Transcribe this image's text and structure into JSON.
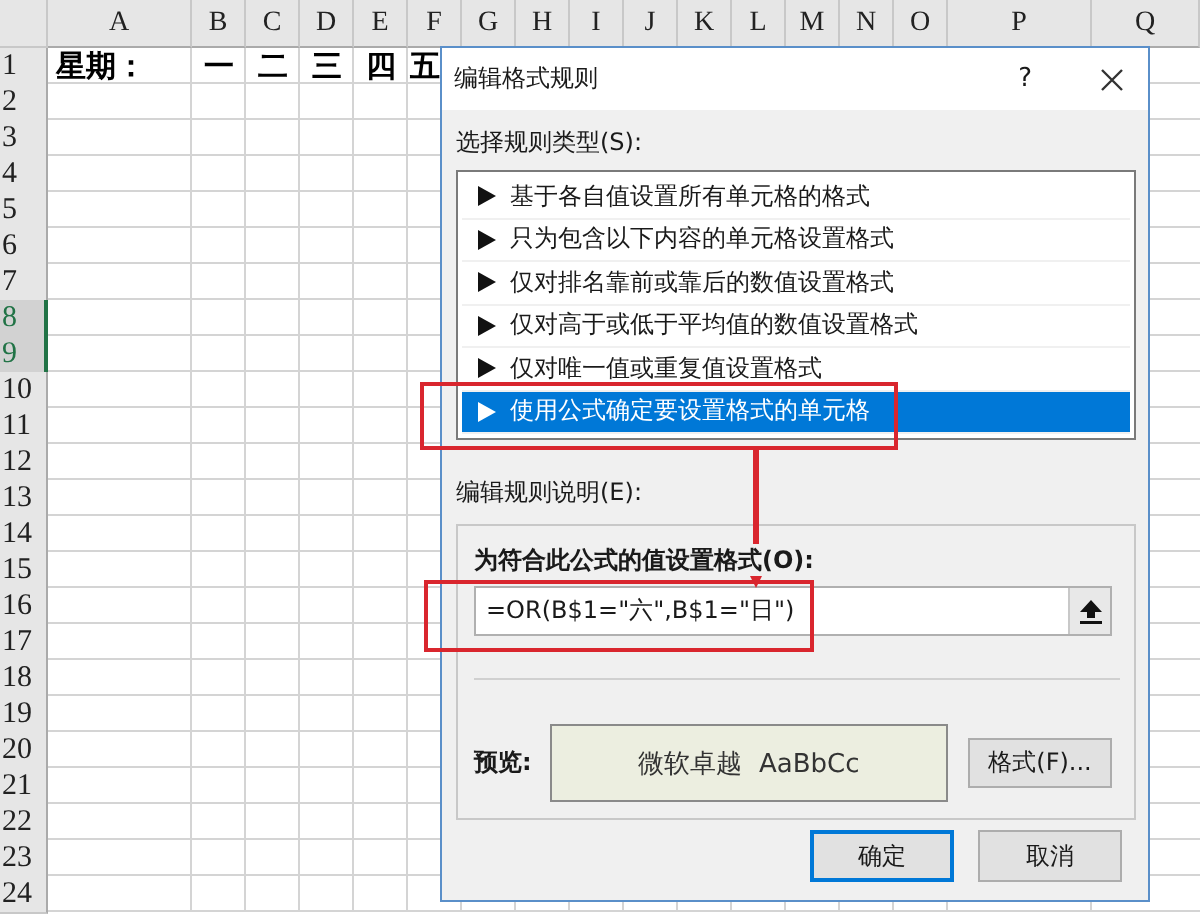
{
  "sheet": {
    "columns": [
      "A",
      "B",
      "C",
      "D",
      "E",
      "F",
      "G",
      "H",
      "I",
      "J",
      "K",
      "L",
      "M",
      "N",
      "O",
      "P",
      "Q"
    ],
    "rows": [
      {
        "label": "1",
        "selected": false,
        "cells": [
          "星期：",
          "一",
          "二",
          "三",
          "四",
          "五"
        ]
      },
      {
        "label": "2",
        "selected": false
      },
      {
        "label": "3",
        "selected": false
      },
      {
        "label": "4",
        "selected": false
      },
      {
        "label": "5",
        "selected": false
      },
      {
        "label": "6",
        "selected": false
      },
      {
        "label": "7",
        "selected": false
      },
      {
        "label": "8",
        "selected": true
      },
      {
        "label": "9",
        "selected": true
      },
      {
        "label": "10",
        "selected": false
      },
      {
        "label": "11",
        "selected": false
      },
      {
        "label": "12",
        "selected": false
      },
      {
        "label": "13",
        "selected": false
      },
      {
        "label": "14",
        "selected": false
      },
      {
        "label": "15",
        "selected": false
      },
      {
        "label": "16",
        "selected": false
      },
      {
        "label": "17",
        "selected": false
      },
      {
        "label": "18",
        "selected": false
      },
      {
        "label": "19",
        "selected": false
      },
      {
        "label": "20",
        "selected": false
      },
      {
        "label": "21",
        "selected": false
      },
      {
        "label": "22",
        "selected": false
      },
      {
        "label": "23",
        "selected": false
      },
      {
        "label": "24",
        "selected": false
      }
    ]
  },
  "dialog": {
    "title": "编辑格式规则",
    "help": "?",
    "rule_type_label": "选择规则类型(S):",
    "rule_types": [
      {
        "label": "基于各自值设置所有单元格的格式",
        "selected": false
      },
      {
        "label": "只为包含以下内容的单元格设置格式",
        "selected": false
      },
      {
        "label": "仅对排名靠前或靠后的数值设置格式",
        "selected": false
      },
      {
        "label": "仅对高于或低于平均值的数值设置格式",
        "selected": false
      },
      {
        "label": "仅对唯一值或重复值设置格式",
        "selected": false
      },
      {
        "label": "使用公式确定要设置格式的单元格",
        "selected": true
      }
    ],
    "description_label": "编辑规则说明(E):",
    "formula_label": "为符合此公式的值设置格式(O):",
    "formula": "=OR(B$1=\"六\",B$1=\"日\")",
    "preview_label": "预览:",
    "preview_text": "微软卓越  AaBbCc",
    "format_button": "格式(F)...",
    "buttons": [
      "确定",
      "取消"
    ]
  },
  "annotations": [
    {
      "kind": "box"
    },
    {
      "kind": "box"
    },
    {
      "kind": "arrow"
    }
  ]
}
